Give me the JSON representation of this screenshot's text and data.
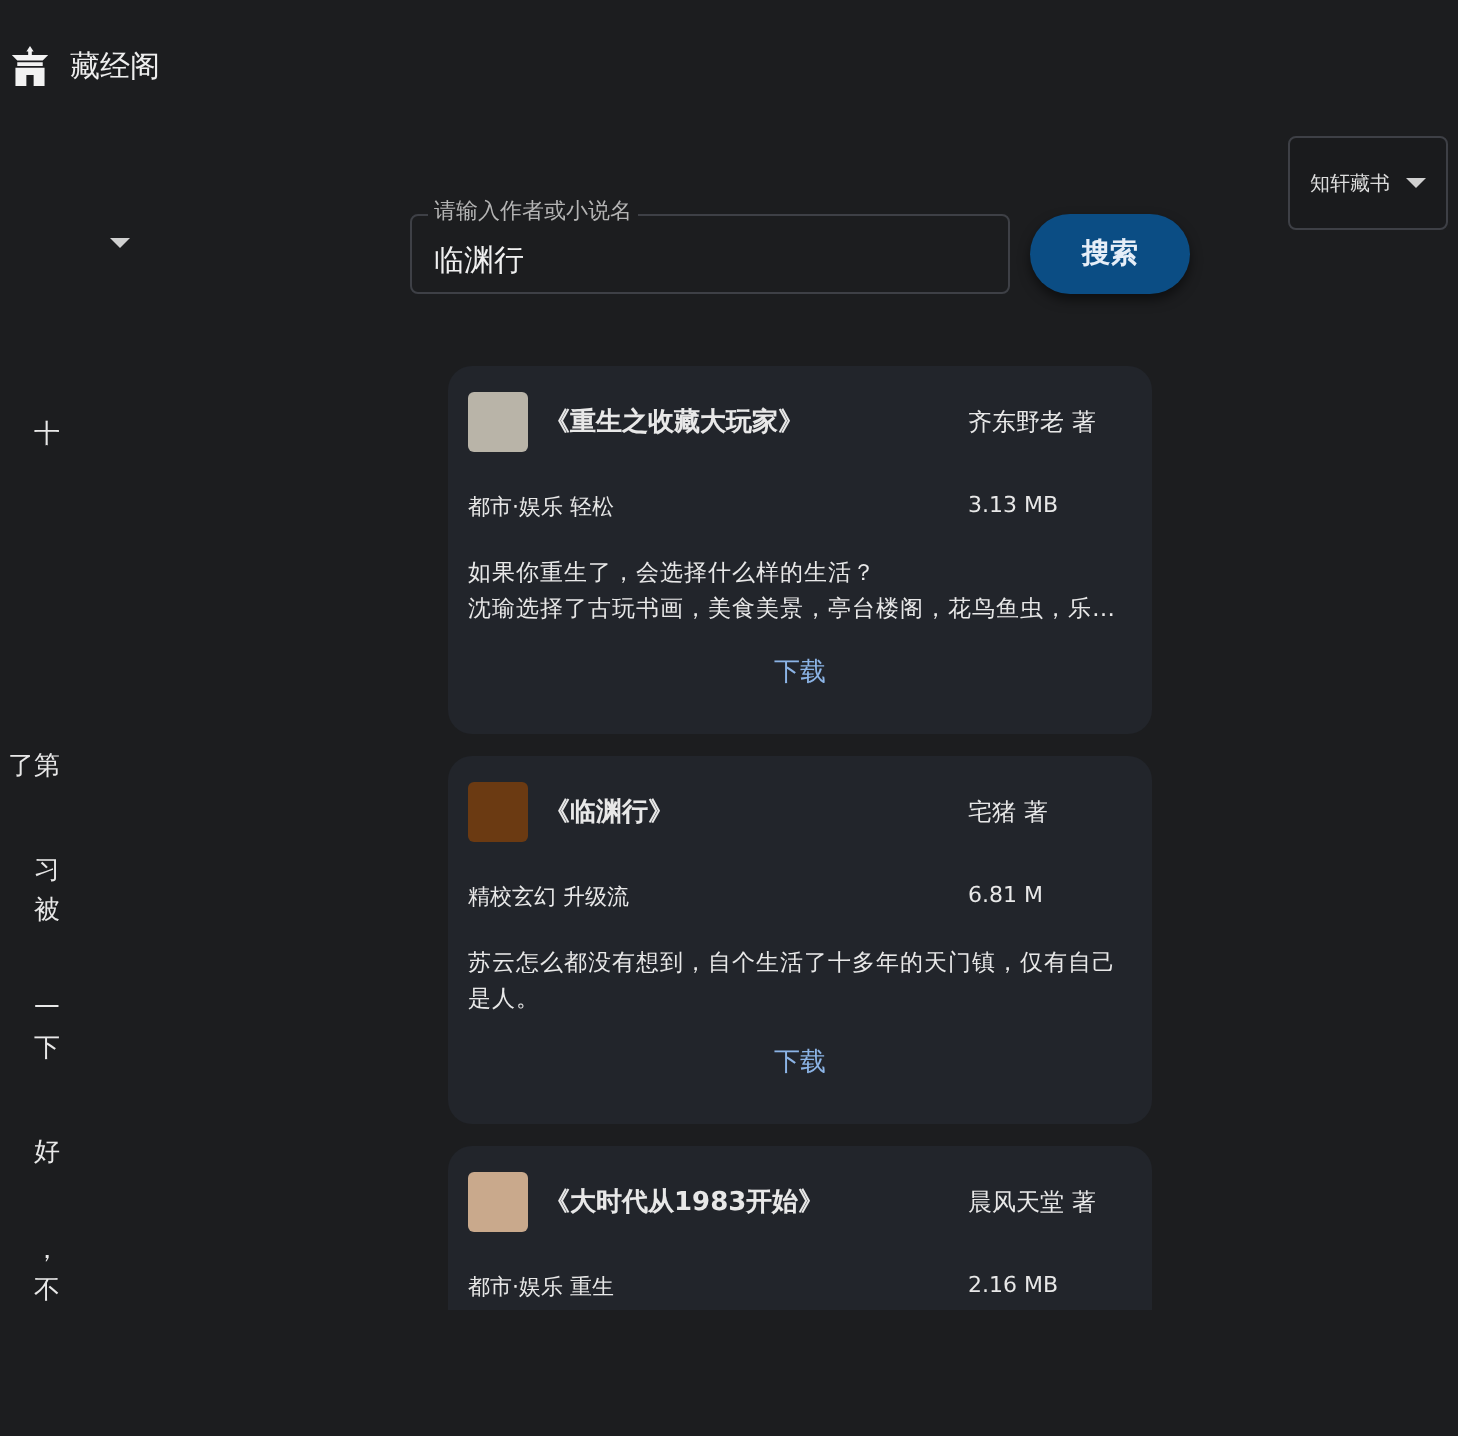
{
  "app": {
    "title": "藏经阁"
  },
  "search": {
    "label": "请输入作者或小说名",
    "value": "临渊行",
    "button": "搜索"
  },
  "source_select": {
    "value": "知轩藏书"
  },
  "side_fragments": [
    [
      "十"
    ],
    [
      "了第"
    ],
    [
      "习",
      "被"
    ],
    [
      "一",
      "下"
    ],
    [
      "好"
    ],
    [
      "，",
      "不"
    ]
  ],
  "books": [
    {
      "title": "《重生之收藏大玩家》",
      "author": "齐东野老 著",
      "tags": "都市·娱乐 轻松",
      "size": "3.13 MB",
      "description": [
        "如果你重生了，会选择什么样的生活？",
        "沈瑜选择了古玩书画，美食美景，亭台楼阁，花鸟鱼虫，乐…"
      ],
      "action": "下载"
    },
    {
      "title": "《临渊行》",
      "author": "宅猪 著",
      "tags": "精校玄幻 升级流",
      "size": "6.81 M",
      "description": [
        "苏云怎么都没有想到，自个生活了十多年的天门镇，仅有自己是人。"
      ],
      "action": "下载"
    },
    {
      "title": "《大时代从1983开始》",
      "author": "晨风天堂 著",
      "tags": "都市·娱乐 重生",
      "size": "2.16 MB"
    }
  ]
}
